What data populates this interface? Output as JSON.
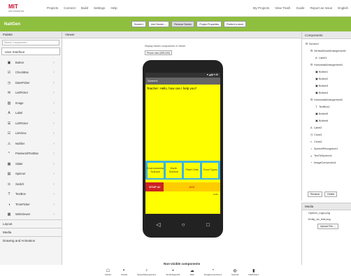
{
  "topbar": {
    "logo_title": "MIT",
    "logo_sub": "APP INVENTOR",
    "menu": [
      "Projects",
      "Connect",
      "Build",
      "Settings",
      "Help"
    ],
    "right": [
      "My Projects",
      "View Trash",
      "Guide",
      "Report an Issue",
      "English"
    ]
  },
  "project": {
    "name": "NaitGen",
    "buttons": [
      "Screen1",
      "Add Screen ...",
      "Remove Screen",
      "Project Properties",
      "Publish to store"
    ]
  },
  "palette": {
    "title": "Palette",
    "search_placeholder": "Search Components...",
    "ui_header": "User Interface",
    "items": [
      {
        "icon": "▣",
        "label": "Button"
      },
      {
        "icon": "☑",
        "label": "CheckBox"
      },
      {
        "icon": "◷",
        "label": "DatePicker"
      },
      {
        "icon": "✉",
        "label": "ListPicker"
      },
      {
        "icon": "▨",
        "label": "Image"
      },
      {
        "icon": "A",
        "label": "Label"
      },
      {
        "icon": "☰",
        "label": "ListPicker"
      },
      {
        "icon": "☷",
        "label": "ListView"
      },
      {
        "icon": "⚠",
        "label": "Notifier"
      },
      {
        "icon": "*",
        "label": "PasswordTextBox"
      },
      {
        "icon": "▦",
        "label": "Slider"
      },
      {
        "icon": "▤",
        "label": "Spinner"
      },
      {
        "icon": "⊙",
        "label": "Switch"
      },
      {
        "icon": "T",
        "label": "TextBox"
      },
      {
        "icon": "◑",
        "label": "TimePicker"
      },
      {
        "icon": "▩",
        "label": "WebViewer"
      }
    ],
    "categories": [
      "Layout",
      "Media",
      "Drawing and Animation"
    ]
  },
  "viewer": {
    "title": "Viewer",
    "hidden_label": "Display hidden components in Viewer",
    "size_select": "Phone size (505,320)"
  },
  "phone": {
    "status": "▼◢ ▮ 9:48",
    "screen_title": "Screen1",
    "chat": "Teacher: Hello, how can I help you?",
    "buttons": [
      "Environmental Science",
      "Earth Science",
      "Plant Cells",
      "Food Types"
    ],
    "stop": "STOP AI",
    "ask": "ASK",
    "small": "Hello"
  },
  "nonvisible": {
    "title": "Non-visible components",
    "items": [
      {
        "icon": "☖",
        "label": "Clock1"
      },
      {
        "icon": "◐",
        "label": "Clock2"
      },
      {
        "icon": "♪",
        "label": "SpeechRecognizer1"
      },
      {
        "icon": "◒",
        "label": "TextToSpeech1"
      },
      {
        "icon": "☁",
        "label": "Web"
      },
      {
        "icon": "◔",
        "label": "ImageConversion1"
      },
      {
        "icon": "◍",
        "label": "Sound1"
      },
      {
        "icon": "▮",
        "label": "FilePicker1"
      }
    ]
  },
  "components": {
    "title": "Components",
    "tree": [
      {
        "depth": 0,
        "icon": "⊟",
        "label": "Screen1"
      },
      {
        "depth": 1,
        "icon": "⊟",
        "label": "VerticalScrollArrangement1"
      },
      {
        "depth": 2,
        "icon": "A",
        "label": "Label1"
      },
      {
        "depth": 1,
        "icon": "⊟",
        "label": "HorizontalArrangement1"
      },
      {
        "depth": 2,
        "icon": "▣",
        "label": "Button1"
      },
      {
        "depth": 2,
        "icon": "▣",
        "label": "Button2"
      },
      {
        "depth": 2,
        "icon": "▣",
        "label": "Button3"
      },
      {
        "depth": 2,
        "icon": "▣",
        "label": "Button4"
      },
      {
        "depth": 1,
        "icon": "⊟",
        "label": "HorizontalArrangement2"
      },
      {
        "depth": 2,
        "icon": "T",
        "label": "TextBox1"
      },
      {
        "depth": 2,
        "icon": "▣",
        "label": "Button5"
      },
      {
        "depth": 2,
        "icon": "▣",
        "label": "Button6"
      },
      {
        "depth": 1,
        "icon": "A",
        "label": "Label2"
      },
      {
        "depth": 1,
        "icon": "◷",
        "label": "Clock1"
      },
      {
        "depth": 1,
        "icon": "◐",
        "label": "Clock2"
      },
      {
        "depth": 1,
        "icon": "♪",
        "label": "SpeechRecognizer1"
      },
      {
        "depth": 1,
        "icon": "◒",
        "label": "TextToSpeech1"
      },
      {
        "depth": 1,
        "icon": "◔",
        "label": "ImageConversion1"
      }
    ],
    "rename": "Rename",
    "delete": "Delete"
  },
  "media": {
    "title": "Media",
    "lines": [
      "OpenAI_Logo.png",
      "Emily_vic_trial.png"
    ],
    "upload": "Upload File ..."
  }
}
